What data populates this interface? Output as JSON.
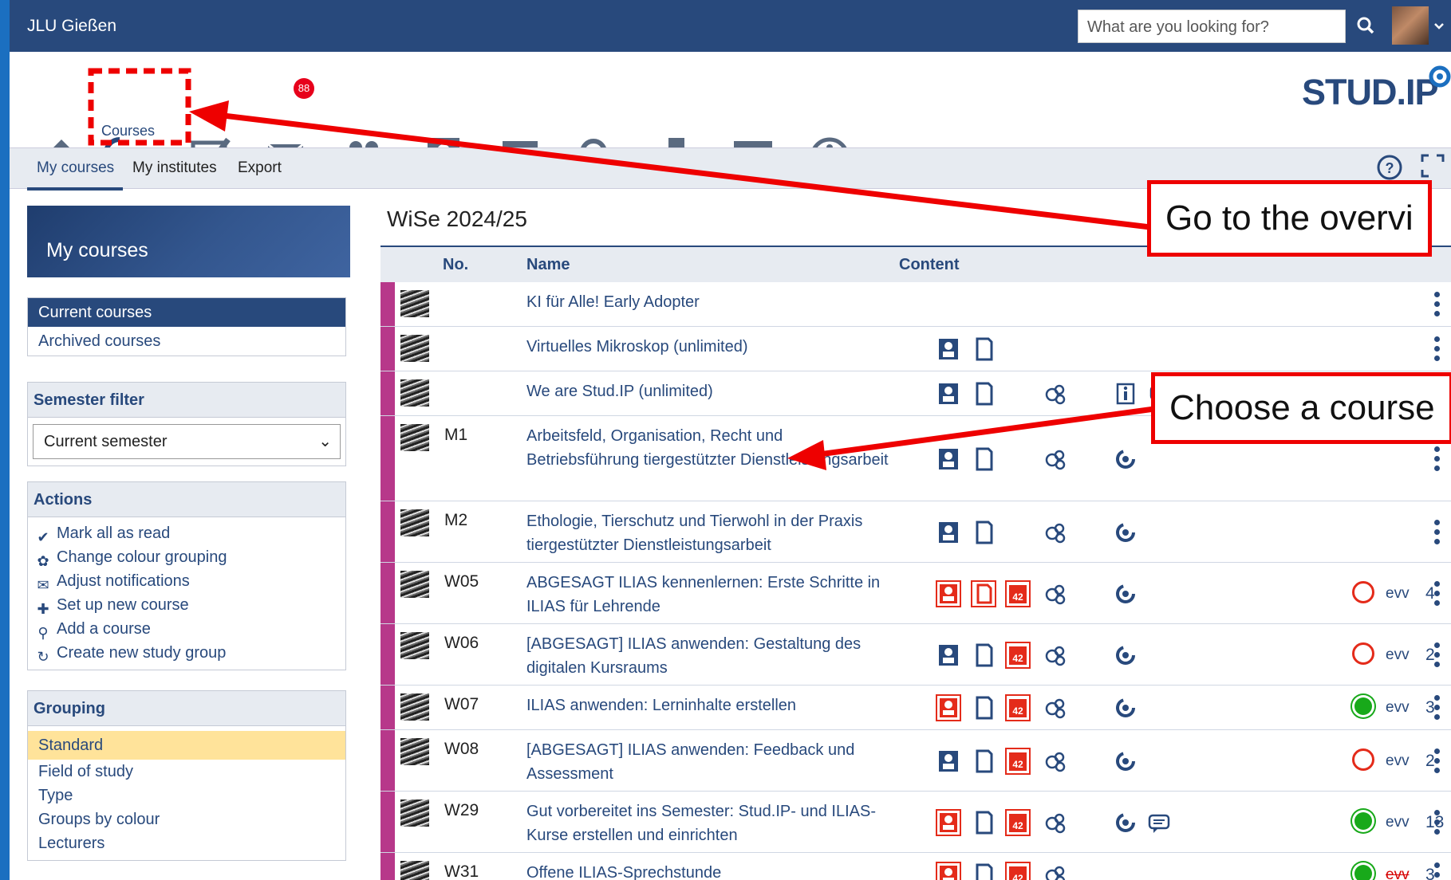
{
  "header": {
    "brand": "JLU Gießen",
    "search_placeholder": "What are you looking for?"
  },
  "nav": {
    "courses_label": "Courses",
    "mail_badge": "88",
    "logo": "STUD.IP"
  },
  "subnav": {
    "tabs": [
      "My courses",
      "My institutes",
      "Export"
    ]
  },
  "sidebar": {
    "title": "My courses",
    "views": [
      "Current courses",
      "Archived courses"
    ],
    "semester_filter": {
      "title": "Semester filter",
      "value": "Current semester"
    },
    "actions": {
      "title": "Actions",
      "items": [
        {
          "icon": "check-icon",
          "label": "Mark all as read"
        },
        {
          "icon": "palette-icon",
          "label": "Change colour grouping"
        },
        {
          "icon": "mail-icon",
          "label": "Adjust notifications"
        },
        {
          "icon": "plus-icon",
          "label": "Set up new course"
        },
        {
          "icon": "search-icon",
          "label": "Add a course"
        },
        {
          "icon": "study-group-icon",
          "label": "Create new study group"
        }
      ]
    },
    "grouping": {
      "title": "Grouping",
      "items": [
        "Standard",
        "Field of study",
        "Type",
        "Groups by colour",
        "Lecturers"
      ]
    }
  },
  "main": {
    "semester": "WiSe 2024/25",
    "columns": {
      "no": "No.",
      "name": "Name",
      "content": "Content"
    },
    "rows": [
      {
        "no": "",
        "name": "KI für Alle! Early Adopter",
        "evv": "",
        "count": ""
      },
      {
        "no": "",
        "name": "Virtuelles Mikroskop (unlimited)",
        "evv": "",
        "count": ""
      },
      {
        "no": "",
        "name": "We are Stud.IP (unlimited)",
        "evv": "",
        "count": ""
      },
      {
        "no": "M1",
        "name": "Arbeitsfeld, Organisation, Recht und Betriebsführung tiergestützter Dienstleistungsarbeit",
        "evv": "",
        "count": ""
      },
      {
        "no": "M2",
        "name": "Ethologie, Tierschutz und Tierwohl in der Praxis tiergestützter Dienstleistungsarbeit",
        "evv": "",
        "count": ""
      },
      {
        "no": "W05",
        "name": "ABGESAGT ILIAS kennenlernen: Erste Schritte in ILIAS für Lehrende",
        "evv": "evv",
        "count": "4"
      },
      {
        "no": "W06",
        "name": "[ABGESAGT] ILIAS anwenden: Gestaltung des digitalen Kursraums",
        "evv": "evv",
        "count": "2"
      },
      {
        "no": "W07",
        "name": "ILIAS anwenden: Lerninhalte erstellen",
        "evv": "evv",
        "count": "3"
      },
      {
        "no": "W08",
        "name": "[ABGESAGT] ILIAS anwenden: Feedback und Assessment",
        "evv": "evv",
        "count": "2"
      },
      {
        "no": "W29",
        "name": "Gut vorbereitet ins Semester: Stud.IP- und ILIAS-Kurse erstellen und einrichten",
        "evv": "evv",
        "count": "13"
      },
      {
        "no": "W31",
        "name": "Offene ILIAS-Sprechstunde",
        "evv": "evv",
        "count": "3"
      }
    ]
  },
  "annotations": {
    "overview": "Go to the overvi",
    "choose": "Choose a course"
  },
  "colors": {
    "primary": "#28497c",
    "accent_red": "#ee0000",
    "stripe": "#b7388a",
    "standard_bg": "#ffe39a"
  }
}
